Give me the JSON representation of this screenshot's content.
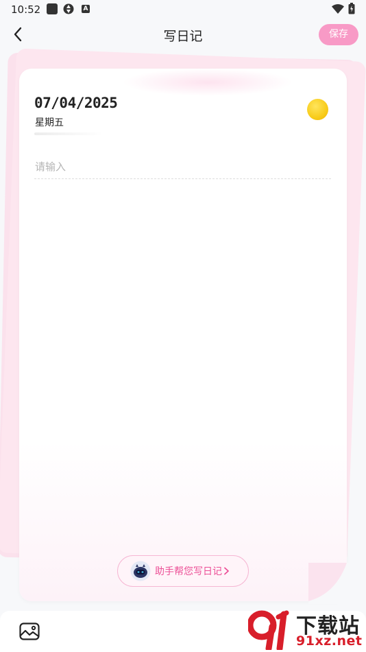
{
  "status_bar": {
    "time": "10:52",
    "icons": [
      "photo-icon",
      "aperture-icon",
      "a-icon",
      "wifi-icon",
      "battery-icon"
    ]
  },
  "header": {
    "title": "写日记",
    "save_label": "保存",
    "back_icon": "chevron-left-icon"
  },
  "diary": {
    "date": "07/04/2025",
    "weekday": "星期五",
    "mood_icon": "sun-icon",
    "input_value": "",
    "input_placeholder": "请输入"
  },
  "assistant": {
    "label": "助手帮您写日记",
    "avatar_icon": "robot-icon",
    "chevron_icon": "chevron-right-icon"
  },
  "toolbar": {
    "image_icon": "image-icon"
  },
  "watermark": {
    "text_cn": "下载站",
    "url": "91xz.net"
  },
  "colors": {
    "accent": "#f89ac6",
    "assistant_text": "#ec4f96",
    "background": "#f7f8fa"
  }
}
